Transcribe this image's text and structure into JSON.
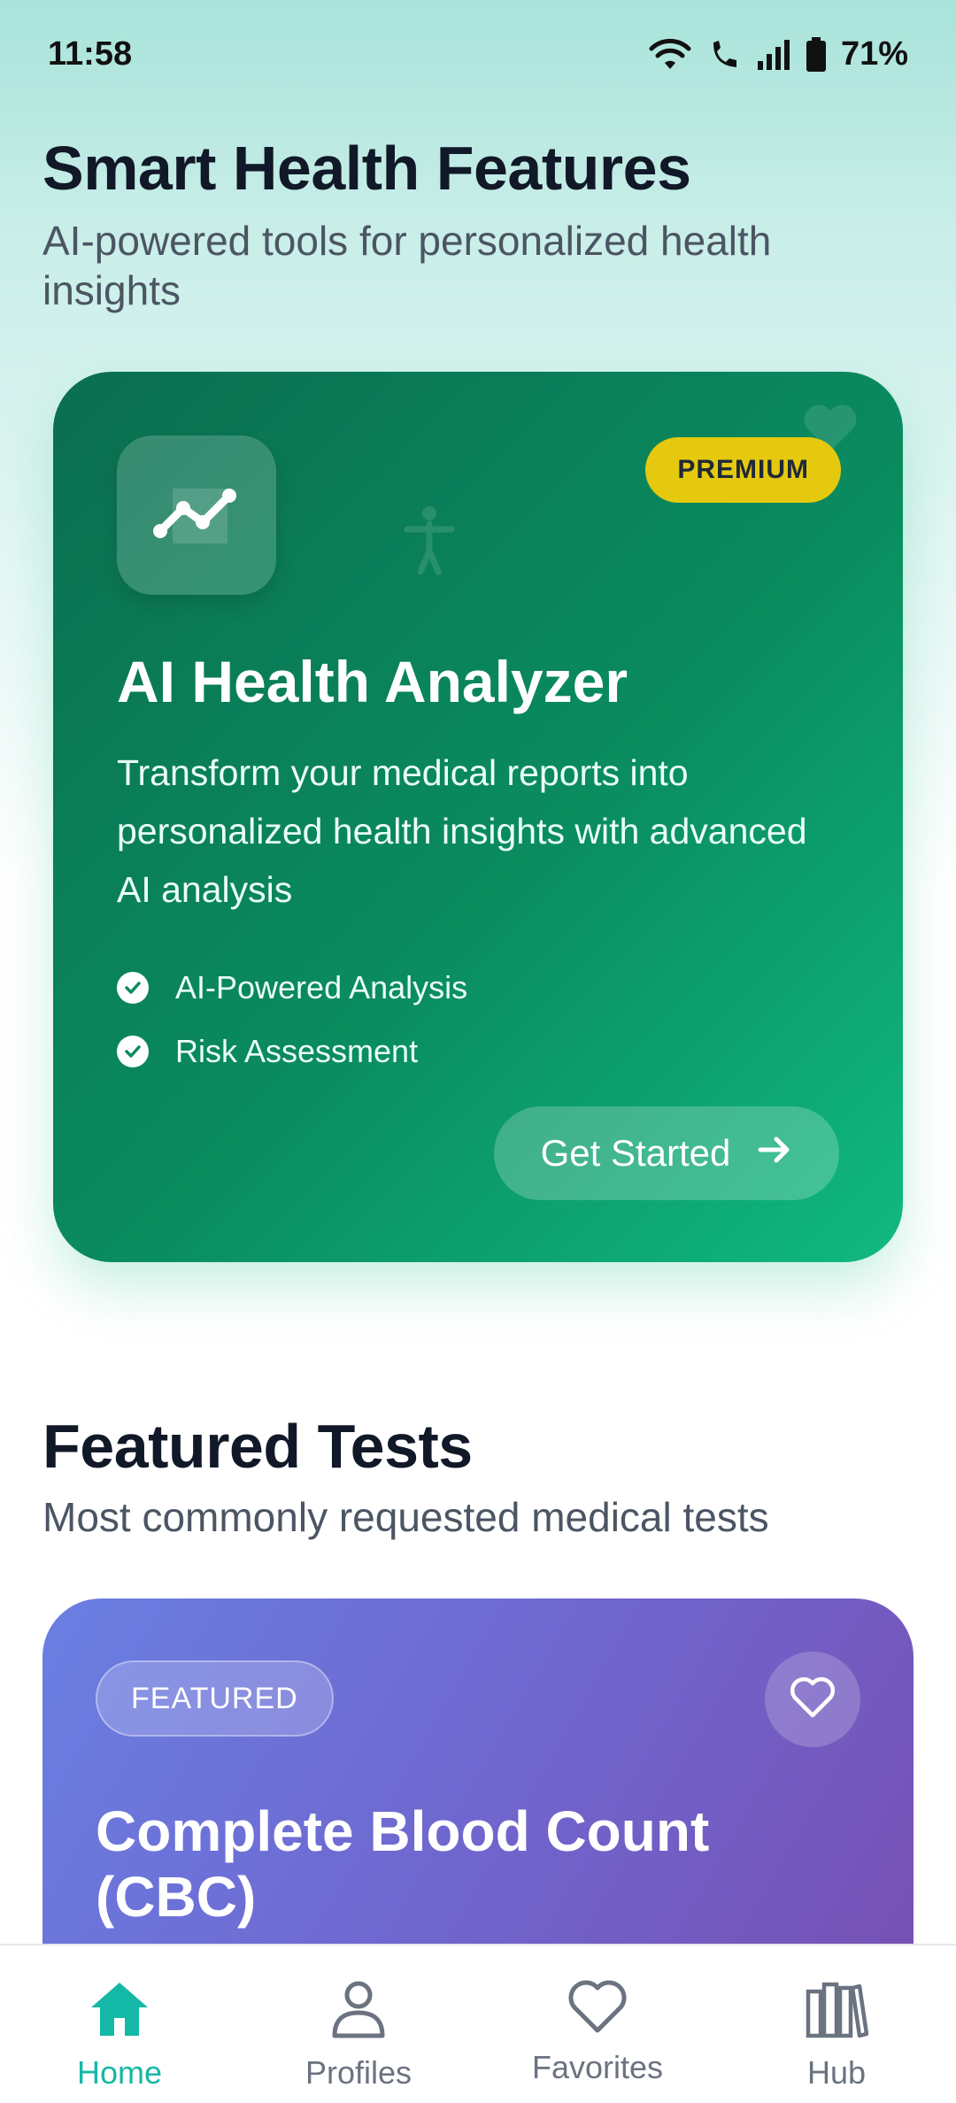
{
  "status_bar": {
    "time": "11:58",
    "battery": "71%"
  },
  "smart_section": {
    "title": "Smart Health Features",
    "subtitle": "AI-powered tools for personalized health insights"
  },
  "ai_card": {
    "badge": "PREMIUM",
    "title": "AI Health Analyzer",
    "description": "Transform your medical reports into personalized health insights with advanced AI analysis",
    "features": [
      "AI-Powered Analysis",
      "Risk Assessment"
    ],
    "cta": "Get Started",
    "icon": "trend-chart-icon",
    "gradient": [
      "#0b6e4f",
      "#10b981"
    ]
  },
  "featured_section": {
    "title": "Featured Tests",
    "subtitle": "Most commonly requested medical tests"
  },
  "test_card": {
    "badge": "FEATURED",
    "title": "Complete Blood Count (CBC)",
    "gradient": [
      "#6a7fe2",
      "#7750b4"
    ]
  },
  "bottom_nav": {
    "items": [
      {
        "label": "Home",
        "icon": "home-icon",
        "active": true
      },
      {
        "label": "Profiles",
        "icon": "person-icon",
        "active": false
      },
      {
        "label": "Favorites",
        "icon": "heart-icon",
        "active": false
      },
      {
        "label": "Hub",
        "icon": "library-icon",
        "active": false
      }
    ],
    "active_color": "#14b8a6"
  }
}
